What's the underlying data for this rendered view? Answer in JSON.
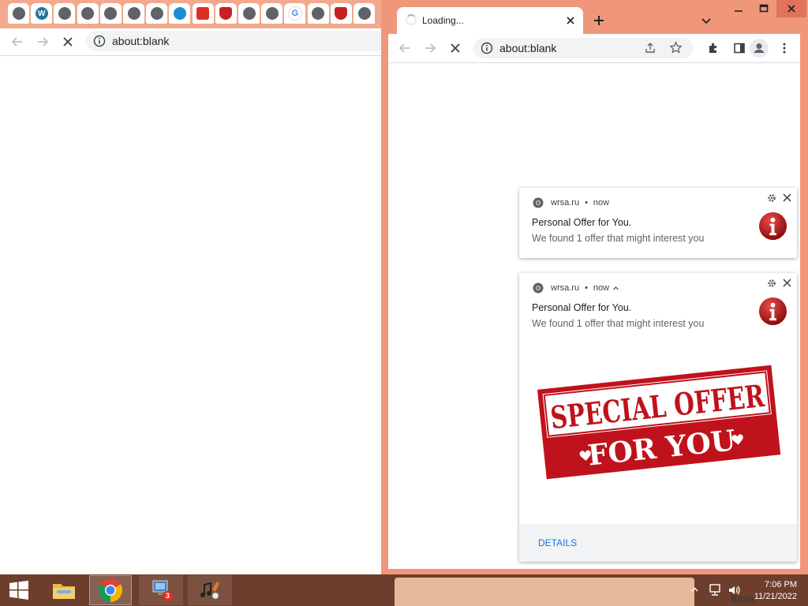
{
  "left_window": {
    "tab_favicons": [
      "globe-icon",
      "wordpress-icon",
      "globe-icon",
      "globe-icon",
      "globe-icon",
      "globe-icon",
      "globe-icon",
      "bird-icon",
      "phone-icon",
      "shield-icon",
      "globe-icon",
      "globe-icon",
      "google-icon",
      "globe-icon",
      "shield-icon",
      "globe-icon"
    ],
    "url": "about:blank"
  },
  "right_window": {
    "tab_title": "Loading...",
    "url": "about:blank"
  },
  "notifications": [
    {
      "origin": "wrsa.ru",
      "time": "now",
      "title": "Personal Offer for You.",
      "message": "We found 1 offer that might interest you"
    },
    {
      "origin": "wrsa.ru",
      "time": "now",
      "title": "Personal Offer for You.",
      "message": "We found 1 offer that might interest you",
      "image_line1": "SPECIAL OFFER",
      "image_line2": "FOR YOU",
      "action": "DETAILS"
    }
  ],
  "taskbar": {
    "badge_count": "3",
    "time": "7:06 PM",
    "date": "11/21/2022",
    "tray_text": "Bitrix"
  },
  "colors": {
    "frame": "#f0977a",
    "taskbar": "#6e3e2c",
    "offer_red": "#c0121c",
    "link_blue": "#1a73e8"
  }
}
